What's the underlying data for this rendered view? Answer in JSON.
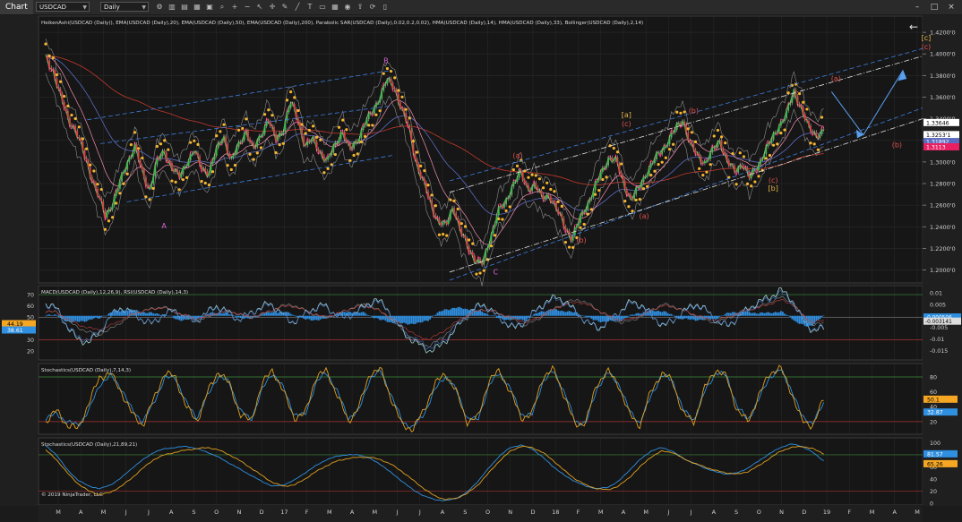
{
  "toolbar": {
    "chart_tab": "Chart",
    "instrument": "USDCAD",
    "timeframe": "Daily",
    "tools": [
      "gear-icon",
      "chart-type-icon",
      "bar-style-icon",
      "properties-icon",
      "template-icon",
      "search-icon",
      "zoom-in-icon",
      "zoom-out-icon",
      "pointer-icon",
      "crosshair-icon",
      "draw-icon",
      "line-icon",
      "text-icon",
      "region-icon",
      "grid-icon",
      "camera-icon",
      "share-icon",
      "sync-icon",
      "layout-icon"
    ],
    "window_buttons": [
      "–",
      "□",
      "×"
    ]
  },
  "colors": {
    "background": "#161616",
    "grid": "#2a2a2a",
    "candle": "#cfcfcf",
    "hma14": "#4caf50",
    "hma33": "#e91e63",
    "ema20": "#f48fb1",
    "ema50": "#5c6bc0",
    "ema200": "#c0392b",
    "sar": "#f5b52e",
    "bollinger": "#bdbdbd",
    "channel_blue": "#3d7ee0",
    "channel_white": "#e0e0e0",
    "wave_orange": "#e8b84a",
    "wave_red": "#e05050",
    "wave_pink": "#d06ad6",
    "macd_hist": "#2f8fe0",
    "stoch_orange": "#e0a020",
    "stoch_blue": "#2f8fe0"
  },
  "chart_data": [
    {
      "type": "line",
      "panel": "price",
      "indicator_label": "HeikenAshi(USDCAD (Daily)), EMA(USDCAD (Daily),20), EMA(USDCAD (Daily),50), EMA(USDCAD (Daily),200), Parabolic SAR(USDCAD (Daily),0.02,0.2,0.02), HMA(USDCAD (Daily),14), HMA(USDCAD (Daily),33), Bollinger(USDCAD (Daily),2,14)",
      "y_ticks": [
        "1.4200'0",
        "1.4000'0",
        "1.3800'0",
        "1.3600'0",
        "1.3400'0",
        "1.3200'0",
        "1.3000'0",
        "1.2800'0",
        "1.2600'0",
        "1.2400'0",
        "1.2200'0",
        "1.2000'0"
      ],
      "y_tick_values": [
        1.42,
        1.4,
        1.38,
        1.36,
        1.34,
        1.32,
        1.3,
        1.28,
        1.26,
        1.24,
        1.22,
        1.2
      ],
      "ylim": [
        1.188,
        1.435
      ],
      "price_labels": [
        {
          "text": "1.33646",
          "value": 1.3365,
          "bg": "#ffffff",
          "fg": "#000000"
        },
        {
          "text": "1.3253'1",
          "value": 1.3253,
          "bg": "#ffffff",
          "fg": "#000000"
        },
        {
          "text": "1.31892",
          "value": 1.3189,
          "bg": "#5c6bc0",
          "fg": "#ffffff"
        },
        {
          "text": "1.3113",
          "value": 1.314,
          "bg": "#e91e63",
          "fg": "#ffffff"
        }
      ],
      "x_months": [
        "M",
        "A",
        "M",
        "J",
        "J",
        "A",
        "S",
        "O",
        "N",
        "D",
        "17",
        "F",
        "M",
        "A",
        "M",
        "J",
        "J",
        "A",
        "S",
        "O",
        "N",
        "D",
        "18",
        "F",
        "M",
        "A",
        "M",
        "J",
        "J",
        "A",
        "S",
        "O",
        "N",
        "D",
        "19",
        "F",
        "M",
        "A",
        "M"
      ],
      "series": [
        {
          "name": "Price",
          "values": [
            1.395,
            1.385,
            1.36,
            1.34,
            1.33,
            1.31,
            1.29,
            1.27,
            1.25,
            1.262,
            1.28,
            1.3,
            1.315,
            1.29,
            1.275,
            1.3,
            1.31,
            1.295,
            1.285,
            1.3,
            1.31,
            1.295,
            1.29,
            1.31,
            1.325,
            1.3,
            1.315,
            1.33,
            1.31,
            1.325,
            1.34,
            1.32,
            1.33,
            1.355,
            1.34,
            1.315,
            1.32,
            1.31,
            1.3,
            1.315,
            1.33,
            1.31,
            1.32,
            1.335,
            1.345,
            1.36,
            1.375,
            1.37,
            1.35,
            1.33,
            1.3,
            1.28,
            1.26,
            1.245,
            1.24,
            1.26,
            1.235,
            1.22,
            1.21,
            1.205,
            1.23,
            1.255,
            1.26,
            1.28,
            1.29,
            1.275,
            1.28,
            1.265,
            1.27,
            1.255,
            1.24,
            1.23,
            1.245,
            1.26,
            1.275,
            1.29,
            1.305,
            1.3,
            1.28,
            1.265,
            1.275,
            1.29,
            1.3,
            1.31,
            1.32,
            1.33,
            1.34,
            1.315,
            1.305,
            1.3,
            1.31,
            1.32,
            1.3,
            1.29,
            1.3,
            1.285,
            1.295,
            1.31,
            1.32,
            1.335,
            1.345,
            1.365,
            1.35,
            1.33,
            1.325,
            1.33
          ]
        }
      ],
      "wave_labels": [
        {
          "text": "A",
          "x": 0.142,
          "value": 1.2385,
          "color": "#d06ad6"
        },
        {
          "text": "B",
          "x": 0.393,
          "value": 1.3915,
          "color": "#d06ad6"
        },
        {
          "text": "C",
          "x": 0.517,
          "value": 1.196,
          "color": "#d06ad6"
        },
        {
          "text": "(a)",
          "x": 0.542,
          "value": 1.3035,
          "color": "#e05050"
        },
        {
          "text": "(b)",
          "x": 0.614,
          "value": 1.2255,
          "color": "#e05050"
        },
        {
          "text": "[a]",
          "x": 0.665,
          "value": 1.3415,
          "color": "#e8b84a"
        },
        {
          "text": "(c)",
          "x": 0.665,
          "value": 1.333,
          "color": "#e05050"
        },
        {
          "text": "(a)",
          "x": 0.685,
          "value": 1.2475,
          "color": "#e05050"
        },
        {
          "text": "(b)",
          "x": 0.741,
          "value": 1.345,
          "color": "#e05050"
        },
        {
          "text": "(c)",
          "x": 0.831,
          "value": 1.281,
          "color": "#e05050"
        },
        {
          "text": "[b]",
          "x": 0.831,
          "value": 1.2735,
          "color": "#e8b84a"
        },
        {
          "text": "(a)",
          "x": 0.902,
          "value": 1.375,
          "color": "#e05050"
        },
        {
          "text": "(b)",
          "x": 0.971,
          "value": 1.3135,
          "color": "#e05050"
        },
        {
          "text": "[c]",
          "x": 1.004,
          "value": 1.4125,
          "color": "#e8b84a"
        },
        {
          "text": "(c)",
          "x": 1.004,
          "value": 1.4045,
          "color": "#e05050"
        }
      ],
      "copyright": "© 2019 NinjaTrader, LLC"
    },
    {
      "type": "line",
      "panel": "macd_rsi",
      "indicator_label": "MACD(USDCAD (Daily),12,26,9), RSI(USDCAD (Daily),14,3)",
      "y_ticks_left": [
        "70",
        "60",
        "50",
        "40",
        "30",
        "20"
      ],
      "y_tick_values_left": [
        70,
        60,
        50,
        40,
        30,
        20
      ],
      "ylim_left": [
        12,
        78
      ],
      "y_ticks_right": [
        "0.01",
        "0.005",
        "0",
        "-0.005",
        "-0.01",
        "-0.015"
      ],
      "y_tick_values_right": [
        0.01,
        0.005,
        0,
        -0.005,
        -0.01,
        -0.015
      ],
      "ylim_right": [
        -0.019,
        0.013
      ],
      "left_labels": [
        {
          "text": "44.19",
          "value": 44.19,
          "bg": "#f5a623",
          "fg": "#000000"
        },
        {
          "text": "38.61",
          "value": 38.61,
          "bg": "#2f8fe0",
          "fg": "#ffffff"
        }
      ],
      "right_labels": [
        {
          "text": "-0.000506",
          "value": -0.0005,
          "bg": "#2f8fe0",
          "fg": "#ffffff"
        },
        {
          "text": "-0.003141",
          "value": -0.0023,
          "bg": "#dddddd",
          "fg": "#000000"
        }
      ],
      "series": [
        {
          "name": "MACD",
          "values": [
            0.002,
            0.0015,
            -0.002,
            -0.005,
            -0.007,
            -0.008,
            -0.006,
            -0.003,
            0.0,
            0.002,
            0.003,
            0.004,
            0.002,
            0.0,
            -0.002,
            -0.001,
            0.001,
            0.002,
            0.001,
            -0.001,
            0.0,
            0.002,
            0.004,
            0.005,
            0.003,
            0.001,
            -0.001,
            0.0,
            0.002,
            0.004,
            0.005,
            0.003,
            0.0,
            -0.004,
            -0.008,
            -0.012,
            -0.013,
            -0.01,
            -0.006,
            -0.002,
            0.001,
            0.003,
            0.002,
            0.0,
            -0.002,
            -0.004,
            -0.002,
            0.001,
            0.004,
            0.006,
            0.007,
            0.005,
            0.002,
            -0.001,
            -0.003,
            -0.002,
            0.0,
            0.003,
            0.005,
            0.004,
            0.002,
            0.0,
            -0.002,
            -0.003,
            -0.001,
            0.001,
            0.003,
            0.004,
            0.006,
            0.008,
            0.006,
            0.0,
            -0.004,
            -0.003
          ]
        },
        {
          "name": "RSI",
          "values": [
            62,
            58,
            42,
            30,
            28,
            35,
            50,
            58,
            55,
            48,
            44,
            52,
            56,
            50,
            46,
            53,
            60,
            55,
            48,
            52,
            58,
            62,
            55,
            45,
            50,
            57,
            61,
            54,
            49,
            54,
            60,
            66,
            58,
            44,
            32,
            26,
            20,
            24,
            34,
            46,
            56,
            62,
            54,
            46,
            40,
            46,
            56,
            64,
            68,
            62,
            52,
            44,
            40,
            48,
            56,
            64,
            60,
            50,
            42,
            48,
            56,
            62,
            56,
            46,
            42,
            50,
            58,
            64,
            68,
            74,
            66,
            48,
            38,
            40
          ]
        }
      ]
    },
    {
      "type": "line",
      "panel": "stoch_fast",
      "indicator_label": "Stochastics(USDCAD (Daily),7,14,3)",
      "y_ticks": [
        "80",
        "60",
        "40",
        "20"
      ],
      "y_tick_values": [
        80,
        60,
        40,
        20
      ],
      "ylim": [
        3,
        98
      ],
      "right_labels": [
        {
          "text": "50.1",
          "value": 50.1,
          "bg": "#f5a623",
          "fg": "#000000"
        },
        {
          "text": "32.87",
          "value": 32.87,
          "bg": "#2f8fe0",
          "fg": "#ffffff"
        }
      ],
      "series": [
        {
          "name": "K",
          "values": [
            20,
            35,
            15,
            10,
            45,
            80,
            85,
            60,
            30,
            15,
            50,
            85,
            80,
            40,
            20,
            60,
            88,
            70,
            30,
            20,
            70,
            90,
            60,
            25,
            30,
            80,
            88,
            55,
            20,
            40,
            85,
            90,
            50,
            15,
            10,
            35,
            70,
            85,
            60,
            20,
            25,
            75,
            88,
            60,
            25,
            30,
            80,
            90,
            55,
            15,
            20,
            70,
            88,
            70,
            30,
            15,
            60,
            85,
            75,
            30,
            20,
            65,
            90,
            80,
            35,
            20,
            55,
            85,
            92,
            60,
            20,
            15,
            50
          ]
        },
        {
          "name": "D",
          "values": [
            25,
            30,
            20,
            15,
            35,
            70,
            82,
            65,
            35,
            20,
            45,
            78,
            80,
            45,
            25,
            55,
            82,
            72,
            35,
            22,
            62,
            86,
            65,
            30,
            28,
            72,
            86,
            60,
            25,
            35,
            78,
            88,
            55,
            20,
            12,
            30,
            62,
            82,
            62,
            25,
            22,
            68,
            86,
            64,
            30,
            28,
            74,
            88,
            60,
            20,
            18,
            64,
            86,
            72,
            35,
            18,
            54,
            82,
            76,
            35,
            22,
            60,
            86,
            82,
            40,
            22,
            50,
            80,
            90,
            64,
            26,
            18,
            44
          ]
        }
      ]
    },
    {
      "type": "line",
      "panel": "stoch_slow",
      "indicator_label": "Stochastics(USDCAD (Daily),21,89,21)",
      "y_ticks": [
        "100",
        "80",
        "60",
        "40",
        "20",
        "0"
      ],
      "y_tick_values": [
        100,
        80,
        60,
        40,
        20,
        0
      ],
      "ylim": [
        -3,
        108
      ],
      "right_labels": [
        {
          "text": "81.57",
          "value": 81.57,
          "bg": "#2f8fe0",
          "fg": "#ffffff"
        },
        {
          "text": "65.26",
          "value": 65.26,
          "bg": "#f5a623",
          "fg": "#000000"
        }
      ],
      "series": [
        {
          "name": "D",
          "values": [
            88,
            72,
            50,
            32,
            20,
            14,
            18,
            28,
            42,
            58,
            72,
            80,
            84,
            88,
            90,
            92,
            88,
            80,
            70,
            58,
            46,
            34,
            28,
            30,
            40,
            52,
            62,
            70,
            74,
            76,
            76,
            72,
            64,
            52,
            38,
            24,
            12,
            6,
            8,
            16,
            30,
            50,
            70,
            86,
            94,
            92,
            84,
            70,
            54,
            40,
            30,
            24,
            22,
            28,
            42,
            60,
            76,
            86,
            84,
            74,
            66,
            60,
            54,
            50,
            48,
            52,
            62,
            74,
            86,
            92,
            94,
            90,
            82
          ]
        },
        {
          "name": "K",
          "values": [
            95,
            80,
            55,
            38,
            28,
            24,
            30,
            42,
            58,
            72,
            84,
            90,
            92,
            94,
            90,
            84,
            76,
            66,
            56,
            46,
            36,
            28,
            30,
            38,
            50,
            62,
            72,
            78,
            80,
            80,
            74,
            64,
            50,
            36,
            22,
            12,
            6,
            4,
            8,
            18,
            36,
            58,
            78,
            92,
            96,
            90,
            76,
            60,
            46,
            36,
            28,
            24,
            26,
            36,
            54,
            72,
            86,
            92,
            86,
            74,
            66,
            58,
            52,
            48,
            50,
            58,
            70,
            82,
            92,
            98,
            94,
            84,
            70
          ]
        }
      ]
    }
  ]
}
